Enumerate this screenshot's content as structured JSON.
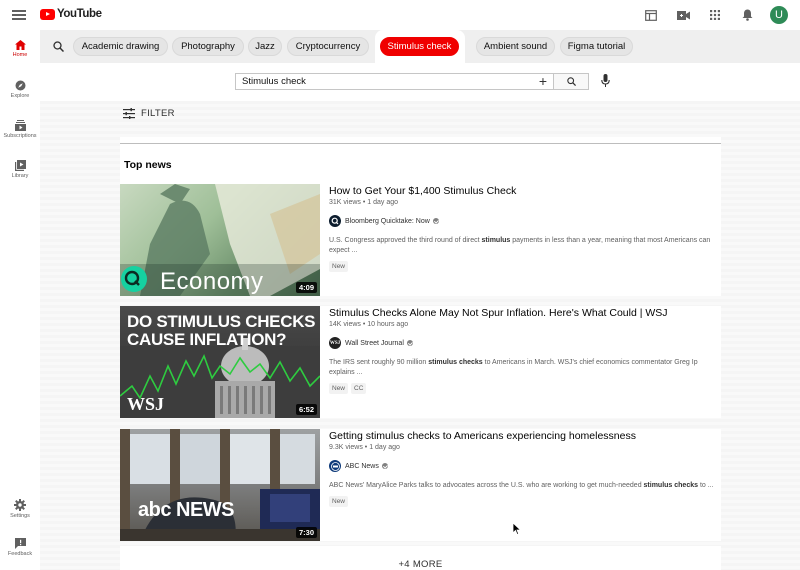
{
  "app": {
    "logo_text": "YouTube",
    "avatar_letter": "U",
    "brand_color": "#ff0000"
  },
  "sidebar": {
    "items": [
      {
        "label": "Home",
        "icon": "home-icon",
        "active": true
      },
      {
        "label": "Explore",
        "icon": "compass-icon"
      },
      {
        "label": "Subscriptions",
        "icon": "subscriptions-icon"
      },
      {
        "label": "Library",
        "icon": "library-icon"
      },
      {
        "label": "Settings",
        "icon": "gear-icon"
      },
      {
        "label": "Feedback",
        "icon": "feedback-icon"
      }
    ]
  },
  "chips": [
    "Academic drawing",
    "Photography",
    "Jazz",
    "Cryptocurrency",
    "Stimulus check",
    "Ambient sound",
    "Figma tutorial"
  ],
  "active_chip": "Stimulus check",
  "search": {
    "query": "Stimulus check"
  },
  "filter": {
    "label": "FILTER"
  },
  "section": {
    "title": "Top news"
  },
  "videos": [
    {
      "title": "How to Get Your $1,400 Stimulus Check",
      "meta": "31K views • 1 day ago",
      "channel": "Bloomberg Quicktake: Now",
      "desc_pre": "U.S. Congress approved the third round of direct ",
      "desc_bold": "stimulus",
      "desc_post": " payments in less than a year, meaning that most Americans can expect ...",
      "badges": [
        "New"
      ],
      "duration": "4:09",
      "thumb_text": "Economy"
    },
    {
      "title": "Stimulus Checks Alone May Not Spur Inflation. Here's What Could | WSJ",
      "meta": "14K views • 10 hours ago",
      "channel": "Wall Street Journal",
      "desc_pre": "The IRS sent roughly 90 million ",
      "desc_bold": "stimulus checks",
      "desc_post": " to Americans in March. WSJ's chief economics commentator Greg Ip explains ...",
      "badges": [
        "New",
        "CC"
      ],
      "duration": "6:52",
      "thumb_line1": "DO STIMULUS CHECKS",
      "thumb_line2": "CAUSE INFLATION?",
      "thumb_logo": "WSJ"
    },
    {
      "title": "Getting stimulus checks to Americans experiencing homelessness",
      "meta": "9.3K views • 1 day ago",
      "channel": "ABC News",
      "desc_pre": "ABC News' MaryAlice Parks talks to advocates across the U.S. who are working to get much-needed ",
      "desc_bold": "stimulus checks",
      "desc_post": " to ...",
      "badges": [
        "New"
      ],
      "duration": "7:30",
      "thumb_logo": "abc NEWS"
    }
  ],
  "more": {
    "label": "+4 MORE"
  }
}
